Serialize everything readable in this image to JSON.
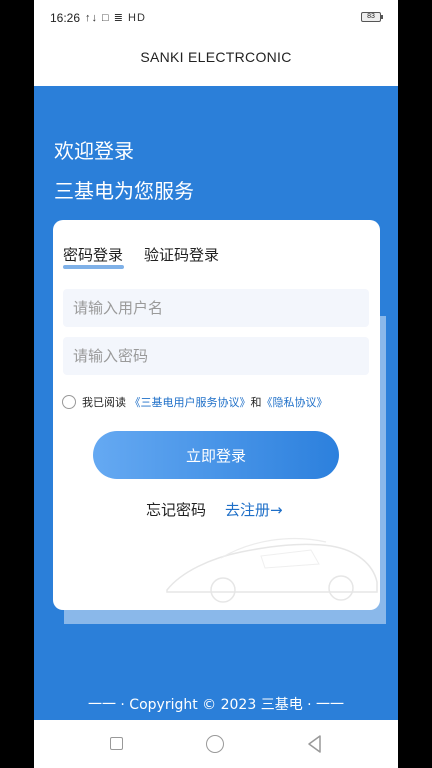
{
  "status_bar": {
    "time": "16:26",
    "icons_text": "↑↓ □ ≣ HD",
    "battery": "83"
  },
  "header": {
    "title": "SANKI ELECTRCONIC"
  },
  "welcome": {
    "line1": "欢迎登录",
    "line2": "三基电为您服务"
  },
  "login_card": {
    "tabs": [
      {
        "label": "密码登录",
        "active": true
      },
      {
        "label": "验证码登录",
        "active": false
      }
    ],
    "username_placeholder": "请输入用户名",
    "username_value": "",
    "password_placeholder": "请输入密码",
    "password_value": "",
    "agreement": {
      "checked": false,
      "prefix": "我已阅读 ",
      "link1": "《三基电用户服务协议》",
      "and": "和",
      "link2": "《隐私协议》"
    },
    "login_label": "立即登录",
    "forgot_label": "忘记密码",
    "register_label": "去注册→"
  },
  "footer": {
    "copyright": "一一 · Copyright © 2023 三基电 · 一一"
  },
  "colors": {
    "primary": "#2b7fd9",
    "link": "#1e6fc8",
    "button_gradient_start": "#65a9f2",
    "button_gradient_end": "#2c80dd"
  },
  "icons": [
    "wifi-icon",
    "signal-icon",
    "battery-icon",
    "nav-recents-icon",
    "nav-home-icon",
    "nav-back-icon"
  ]
}
